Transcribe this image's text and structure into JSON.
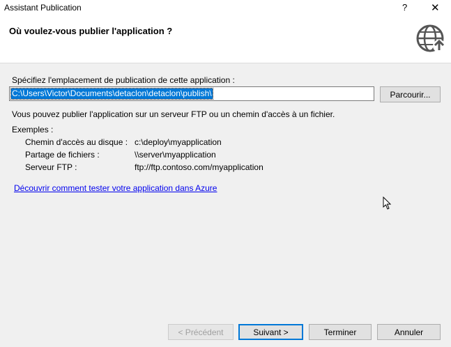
{
  "window": {
    "title": "Assistant Publication",
    "help": "?",
    "close": "✕"
  },
  "header": {
    "heading": "Où voulez-vous publier l'application ?",
    "icon": "globe-publish-icon"
  },
  "form": {
    "location_label": "Spécifiez l'emplacement de publication de cette application :",
    "path_value": "C:\\Users\\Victor\\Documents\\detaclon\\detaclon\\publish\\",
    "browse_label": "Parcourir...",
    "info_text": "Vous pouvez publier l'application sur un serveur FTP ou un chemin d'accès à un fichier.",
    "examples_title": "Exemples :",
    "examples": [
      {
        "label": "Chemin d'accès au disque :",
        "value": "c:\\deploy\\myapplication"
      },
      {
        "label": "Partage de fichiers :",
        "value": "\\\\server\\myapplication"
      },
      {
        "label": "Serveur FTP :",
        "value": "ftp://ftp.contoso.com/myapplication"
      }
    ],
    "azure_link": "Découvrir comment tester votre application dans Azure"
  },
  "footer": {
    "previous": "< Précédent",
    "next": "Suivant >",
    "finish": "Terminer",
    "cancel": "Annuler"
  }
}
